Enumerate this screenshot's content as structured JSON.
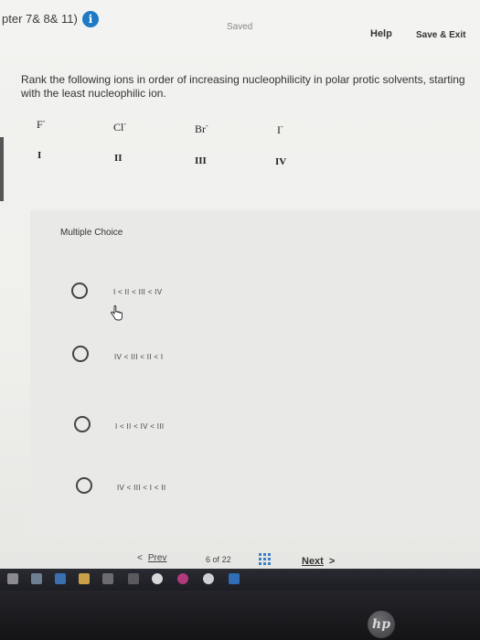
{
  "header": {
    "chapter_title": "pter 7& 8& 11)",
    "info_glyph": "i",
    "status": "Saved",
    "help_label": "Help",
    "save_exit_label": "Save & Exit"
  },
  "question": {
    "prompt": "Rank the following ions in order of increasing nucleophilicity in polar protic solvents, starting with the least nucleophilic ion.",
    "ions": [
      {
        "symbol": "F",
        "charge": "-"
      },
      {
        "symbol": "Cl",
        "charge": "-"
      },
      {
        "symbol": "Br",
        "charge": "-"
      },
      {
        "symbol": "I",
        "charge": "-"
      }
    ],
    "numerals": [
      "I",
      "II",
      "III",
      "IV"
    ]
  },
  "multiple_choice": {
    "label": "Multiple Choice",
    "options": [
      {
        "text": "I < II < III < IV",
        "selected": false
      },
      {
        "text": "IV < III < II < I",
        "selected": false
      },
      {
        "text": "I < II < IV < III",
        "selected": false
      },
      {
        "text": "IV < III < I < II",
        "selected": false
      }
    ]
  },
  "navigation": {
    "prev_glyph": "<",
    "prev_label": "Prev",
    "current_page": "6",
    "of_label": "of",
    "total_pages": "22",
    "next_label": "Next",
    "next_glyph": ">"
  },
  "icons": {
    "info": "info-icon",
    "grid": "grid-icon",
    "cursor": "hand-cursor-icon",
    "brand": "hp-logo"
  },
  "brand": {
    "logo_text": "hp"
  },
  "colors": {
    "accent": "#1f7ac6",
    "grid": "#3d7fc4"
  }
}
